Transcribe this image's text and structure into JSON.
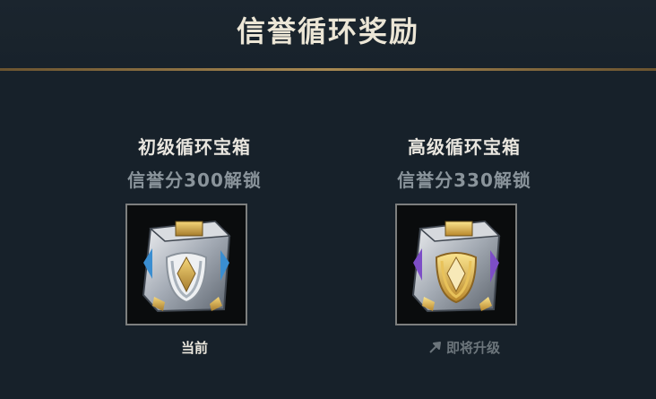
{
  "header": {
    "title": "信誉循环奖励"
  },
  "chests": [
    {
      "name": "初级循环宝箱",
      "requirement": "信誉分300解锁",
      "status": "当前",
      "tier": "silver"
    },
    {
      "name": "高级循环宝箱",
      "requirement": "信誉分330解锁",
      "status": "即将升级",
      "tier": "gold"
    }
  ],
  "colors": {
    "background": "#17212a",
    "gold_line": "#a88952",
    "title": "#ece6d6"
  },
  "icons": {
    "upgrade": "upgrade-arrow-icon"
  }
}
